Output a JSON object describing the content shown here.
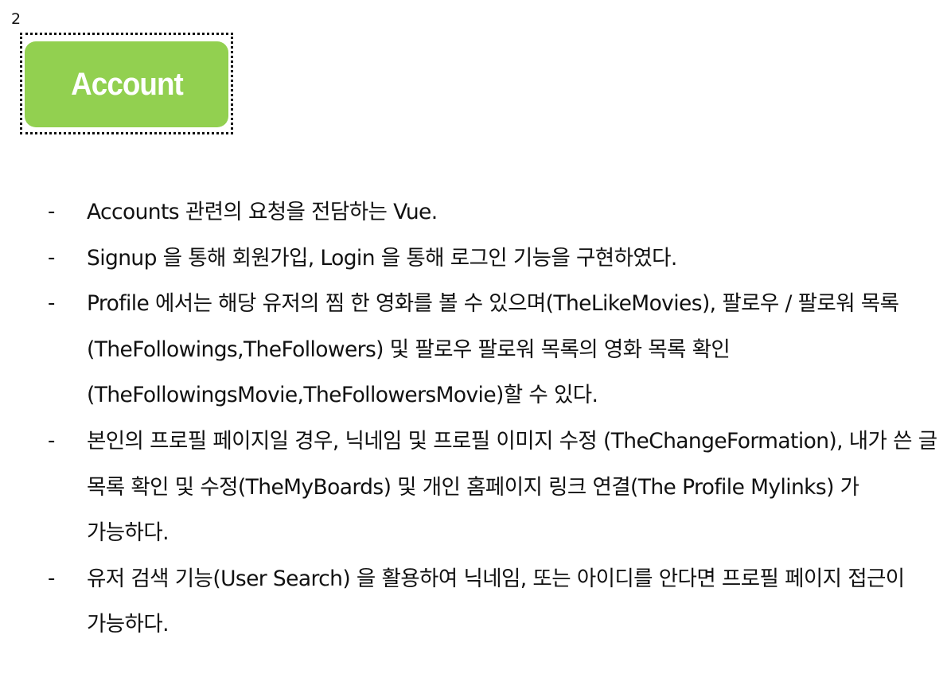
{
  "page": {
    "number": "2"
  },
  "badge": {
    "label": "Account",
    "color": "#92d050"
  },
  "bullets": [
    {
      "dash": "-",
      "text": "Accounts 관련의 요청을 전담하는 Vue."
    },
    {
      "dash": "-",
      "text": "Signup 을 통해 회원가입, Login 을 통해 로그인 기능을 구현하였다."
    },
    {
      "dash": "-",
      "text": "Profile 에서는 해당 유저의 찜 한 영화를 볼 수 있으며(TheLikeMovies), 팔로우 / 팔로워 목록(TheFollowings,TheFollowers) 및 팔로우 팔로워 목록의 영화 목록 확인(TheFollowingsMovie,TheFollowersMovie)할 수 있다."
    },
    {
      "dash": "-",
      "text": "본인의 프로필 페이지일 경우, 닉네임 및 프로필 이미지 수정 (TheChangeFormation), 내가 쓴 글 목록 확인 및 수정(TheMyBoards) 및 개인 홈페이지 링크 연결(The Profile Mylinks) 가 가능하다."
    },
    {
      "dash": "-",
      "text": "유저 검색 기능(User Search) 을 활용하여 닉네임, 또는 아이디를 안다면 프로필 페이지 접근이 가능하다."
    }
  ]
}
